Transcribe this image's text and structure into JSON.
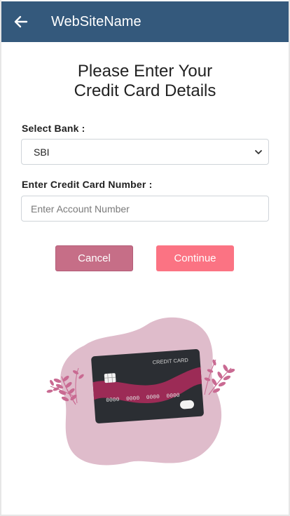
{
  "header": {
    "title": "WebSiteName",
    "back_icon": "arrow-left-icon",
    "color": "#34597c"
  },
  "main": {
    "title_line1": "Please Enter Your",
    "title_line2": "Credit Card Details",
    "bank": {
      "label": "Select Bank :",
      "selected": "SBI"
    },
    "card_number": {
      "label": "Enter Credit Card Number :",
      "value": "",
      "placeholder": "Enter Account Number"
    },
    "buttons": {
      "cancel": "Cancel",
      "continue": "Continue"
    }
  },
  "illustration": {
    "card_title": "CREDIT CARD",
    "card_number": "0000  0000  0000  0000",
    "colors": {
      "blob": "#dfbccb",
      "card_dark": "#2b2e33",
      "card_wave": "#9c2b56",
      "leaves": "#c96a92"
    }
  }
}
